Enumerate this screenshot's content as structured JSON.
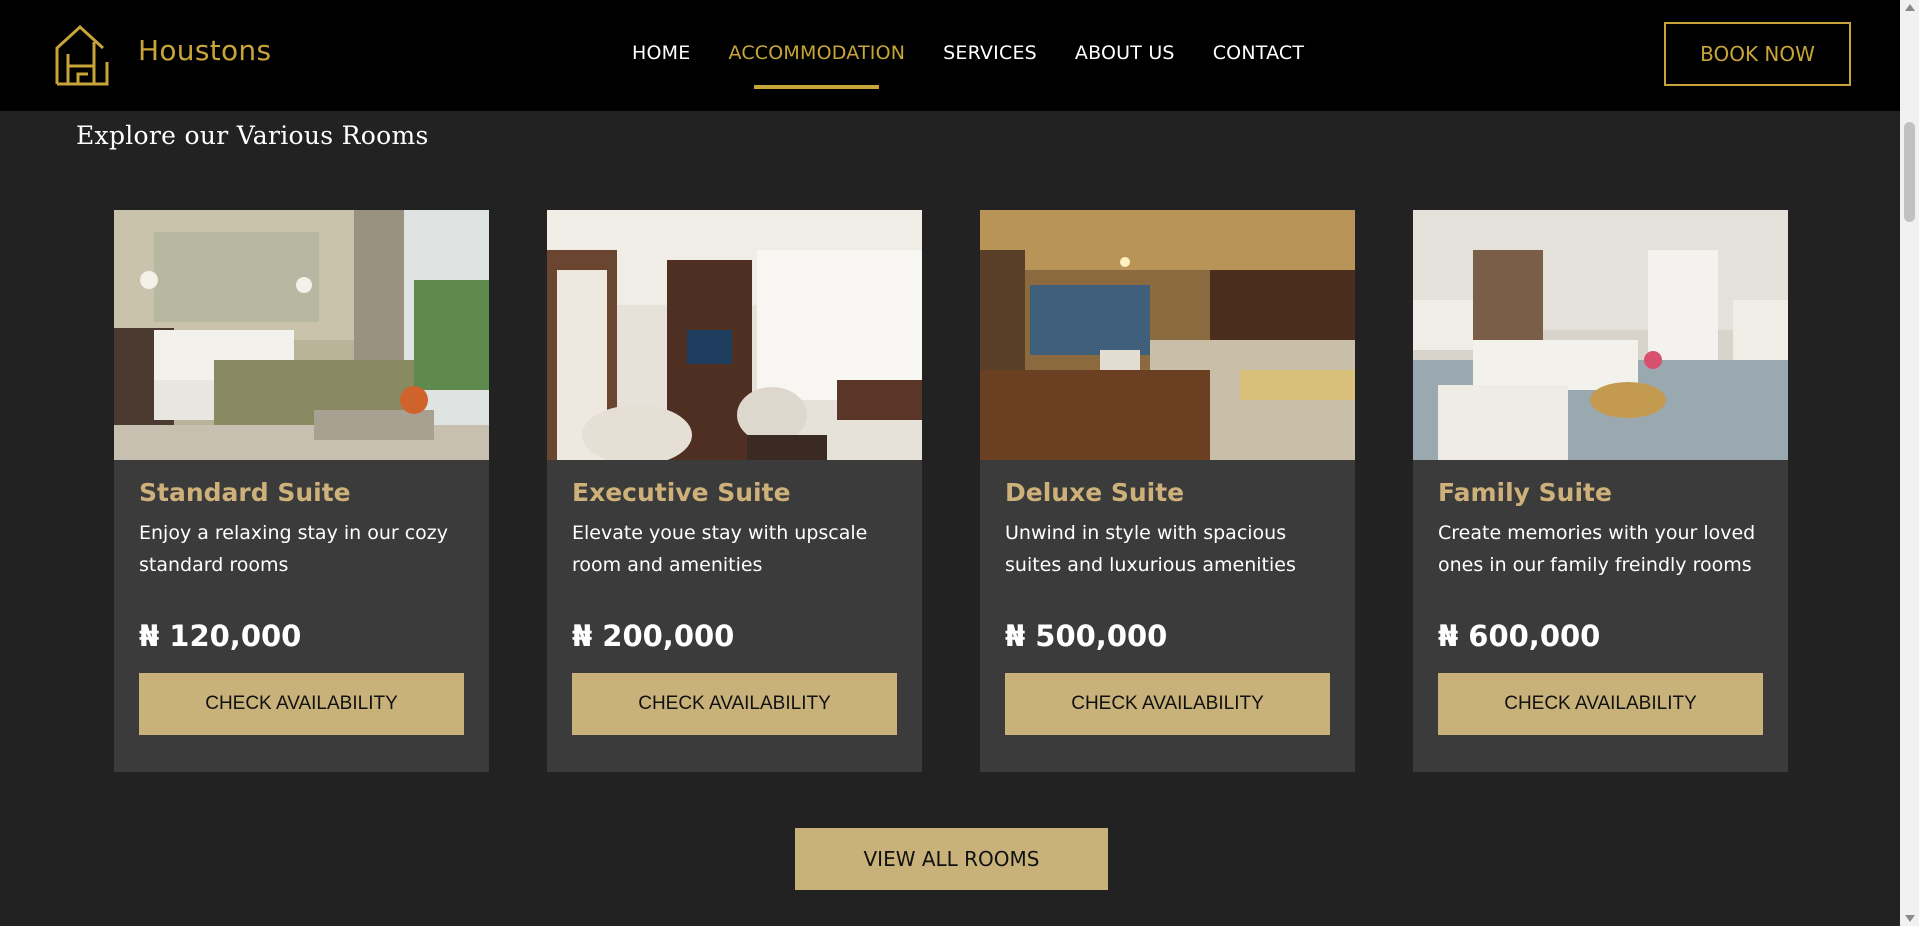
{
  "header": {
    "brand": "Houstons",
    "nav": [
      {
        "label": "HOME",
        "active": false
      },
      {
        "label": "ACCOMMODATION",
        "active": true
      },
      {
        "label": "SERVICES",
        "active": false
      },
      {
        "label": "ABOUT US",
        "active": false
      },
      {
        "label": "CONTACT",
        "active": false
      }
    ],
    "book_label": "BOOK NOW",
    "logo_icon": "house-h-logo-icon"
  },
  "section": {
    "title": "Explore our Various Rooms"
  },
  "rooms": [
    {
      "name": "Standard Suite",
      "desc": "Enjoy a relaxing stay in our cozy standard rooms",
      "price": "₦ 120,000",
      "cta": "CHECK AVAILABILITY",
      "image": "standard-suite-room-photo"
    },
    {
      "name": "Executive Suite",
      "desc": "Elevate youe stay with upscale room and amenities",
      "price": "₦ 200,000",
      "cta": "CHECK AVAILABILITY",
      "image": "executive-suite-room-photo"
    },
    {
      "name": "Deluxe Suite",
      "desc": "Unwind in style with spacious suites and luxurious amenities",
      "price": "₦ 500,000",
      "cta": "CHECK AVAILABILITY",
      "image": "deluxe-suite-room-photo"
    },
    {
      "name": "Family Suite",
      "desc": "Create memories with your loved ones in our family freindly rooms",
      "price": "₦ 600,000",
      "cta": "CHECK AVAILABILITY",
      "image": "family-suite-room-photo"
    }
  ],
  "view_all_label": "VIEW ALL ROOMS",
  "colors": {
    "accent": "#c8a53a",
    "button": "#c8b27a",
    "card_title": "#cdb07a",
    "card_bg": "#3b3b3b",
    "page_bg": "#222222",
    "header_bg": "#000000"
  }
}
